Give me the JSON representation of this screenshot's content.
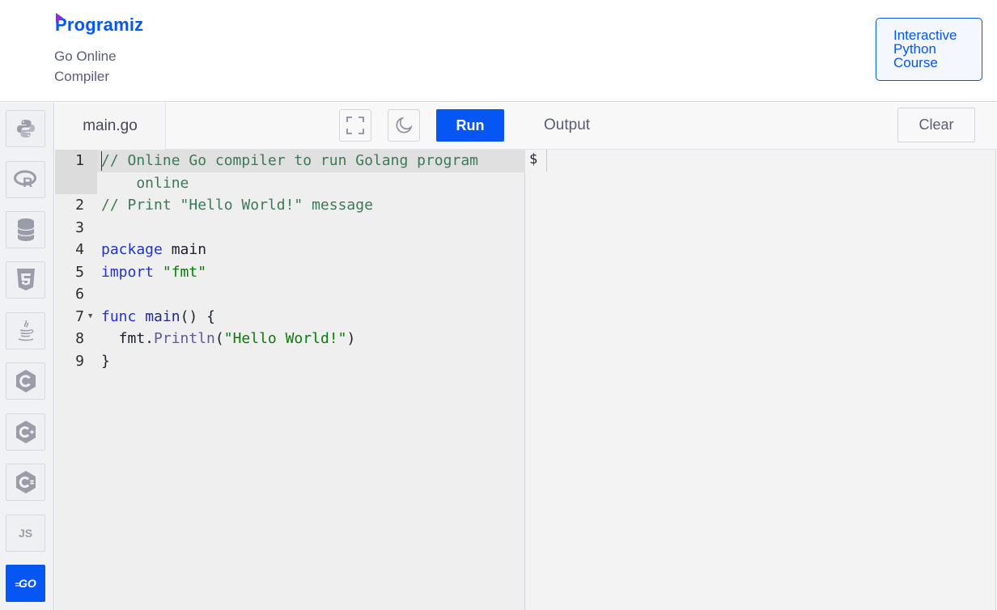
{
  "header": {
    "logo": "Programiz",
    "subtitle_line1": "Go Online",
    "subtitle_line2": "Compiler",
    "course_button": [
      "Interactive",
      "Python",
      "Course"
    ]
  },
  "sidebar": {
    "languages": [
      {
        "name": "python-icon"
      },
      {
        "name": "r-icon"
      },
      {
        "name": "sql-icon"
      },
      {
        "name": "html5-icon"
      },
      {
        "name": "java-icon"
      },
      {
        "name": "c-icon"
      },
      {
        "name": "cpp-icon"
      },
      {
        "name": "csharp-icon"
      },
      {
        "name": "javascript-icon",
        "label": "JS"
      },
      {
        "name": "go-icon",
        "label": "GO",
        "active": true
      }
    ]
  },
  "editor": {
    "file_name": "main.go",
    "run_label": "Run",
    "lines": [
      {
        "num": "1",
        "text": "// Online Go compiler to run Golang program"
      },
      {
        "num": "",
        "text": "    online"
      },
      {
        "num": "2",
        "text": "// Print \"Hello World!\" message"
      },
      {
        "num": "3",
        "text": ""
      },
      {
        "num": "4",
        "text": "package main"
      },
      {
        "num": "5",
        "text": "import \"fmt\""
      },
      {
        "num": "6",
        "text": ""
      },
      {
        "num": "7",
        "text": "func main() {"
      },
      {
        "num": "8",
        "text": "  fmt.Println(\"Hello World!\")"
      },
      {
        "num": "9",
        "text": "}"
      }
    ]
  },
  "output": {
    "title": "Output",
    "clear_label": "Clear",
    "prompt": "$"
  },
  "colors": {
    "accent": "#0556f3",
    "logo_purple": "#8a2be2"
  }
}
